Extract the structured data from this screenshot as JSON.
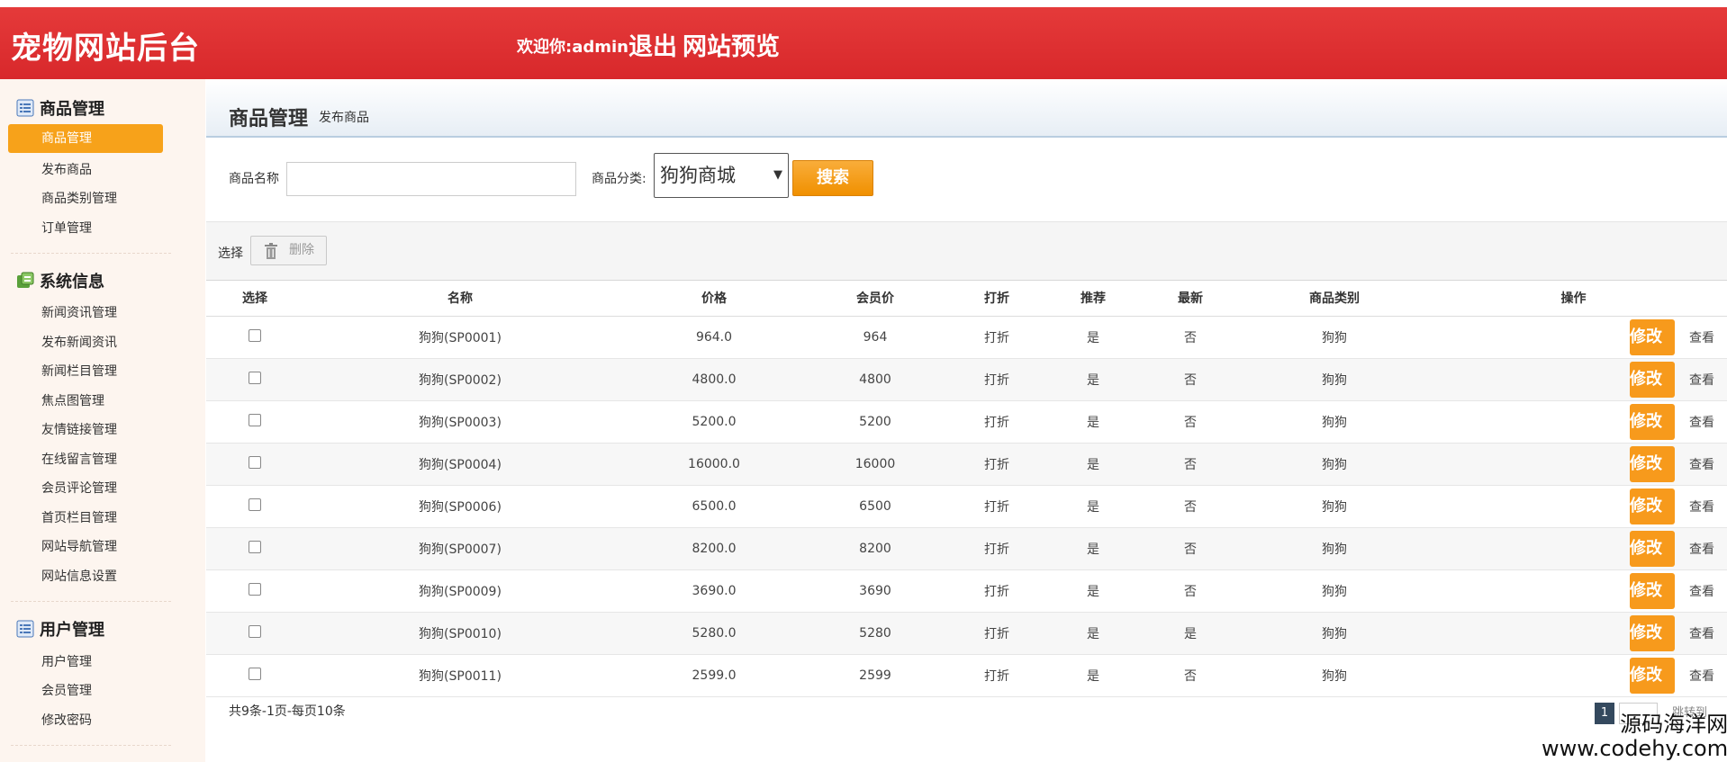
{
  "header": {
    "title": "宠物网站后台",
    "welcome": "欢迎你:admin",
    "logout": "退出",
    "preview": "网站预览"
  },
  "sidebar": {
    "groups": [
      {
        "title": "商品管理",
        "icon": "list-icon",
        "items": [
          "商品管理",
          "发布商品",
          "商品类别管理",
          "订单管理"
        ]
      },
      {
        "title": "系统信息",
        "icon": "info-icon",
        "items": [
          "新闻资讯管理",
          "发布新闻资讯",
          "新闻栏目管理",
          "焦点图管理",
          "友情链接管理",
          "在线留言管理",
          "会员评论管理",
          "首页栏目管理",
          "网站导航管理",
          "网站信息设置"
        ]
      },
      {
        "title": "用户管理",
        "icon": "list-icon",
        "items": [
          "用户管理",
          "会员管理",
          "修改密码"
        ]
      }
    ],
    "active_item": "商品管理"
  },
  "crumb": {
    "title": "商品管理",
    "sub": "发布商品"
  },
  "search": {
    "name_label": "商品名称",
    "name_value": "",
    "category_label": "商品分类:",
    "category_value": "狗狗商城",
    "search_button": "搜索"
  },
  "toolbar": {
    "select_label": "选择",
    "delete_button": "删除"
  },
  "table": {
    "headers": [
      "选择",
      "名称",
      "价格",
      "会员价",
      "打折",
      "推荐",
      "最新",
      "商品类别",
      "操作"
    ],
    "rows": [
      {
        "name": "狗狗(SP0001)",
        "price": "964.0",
        "member_price": "964",
        "discount": "打折",
        "recommend": "是",
        "newest": "否",
        "category": "狗狗"
      },
      {
        "name": "狗狗(SP0002)",
        "price": "4800.0",
        "member_price": "4800",
        "discount": "打折",
        "recommend": "是",
        "newest": "否",
        "category": "狗狗"
      },
      {
        "name": "狗狗(SP0003)",
        "price": "5200.0",
        "member_price": "5200",
        "discount": "打折",
        "recommend": "是",
        "newest": "否",
        "category": "狗狗"
      },
      {
        "name": "狗狗(SP0004)",
        "price": "16000.0",
        "member_price": "16000",
        "discount": "打折",
        "recommend": "是",
        "newest": "否",
        "category": "狗狗"
      },
      {
        "name": "狗狗(SP0006)",
        "price": "6500.0",
        "member_price": "6500",
        "discount": "打折",
        "recommend": "是",
        "newest": "否",
        "category": "狗狗"
      },
      {
        "name": "狗狗(SP0007)",
        "price": "8200.0",
        "member_price": "8200",
        "discount": "打折",
        "recommend": "是",
        "newest": "否",
        "category": "狗狗"
      },
      {
        "name": "狗狗(SP0009)",
        "price": "3690.0",
        "member_price": "3690",
        "discount": "打折",
        "recommend": "是",
        "newest": "否",
        "category": "狗狗"
      },
      {
        "name": "狗狗(SP0010)",
        "price": "5280.0",
        "member_price": "5280",
        "discount": "打折",
        "recommend": "是",
        "newest": "是",
        "category": "狗狗"
      },
      {
        "name": "狗狗(SP0011)",
        "price": "2599.0",
        "member_price": "2599",
        "discount": "打折",
        "recommend": "是",
        "newest": "否",
        "category": "狗狗"
      }
    ],
    "edit_label": "修改",
    "view_label": "查看"
  },
  "pagination": {
    "info": "共9条-1页-每页10条",
    "current": "1",
    "jump_label": "跳转到"
  },
  "watermark": {
    "line1": "源码海洋网",
    "line2": "www.codehy.com"
  }
}
